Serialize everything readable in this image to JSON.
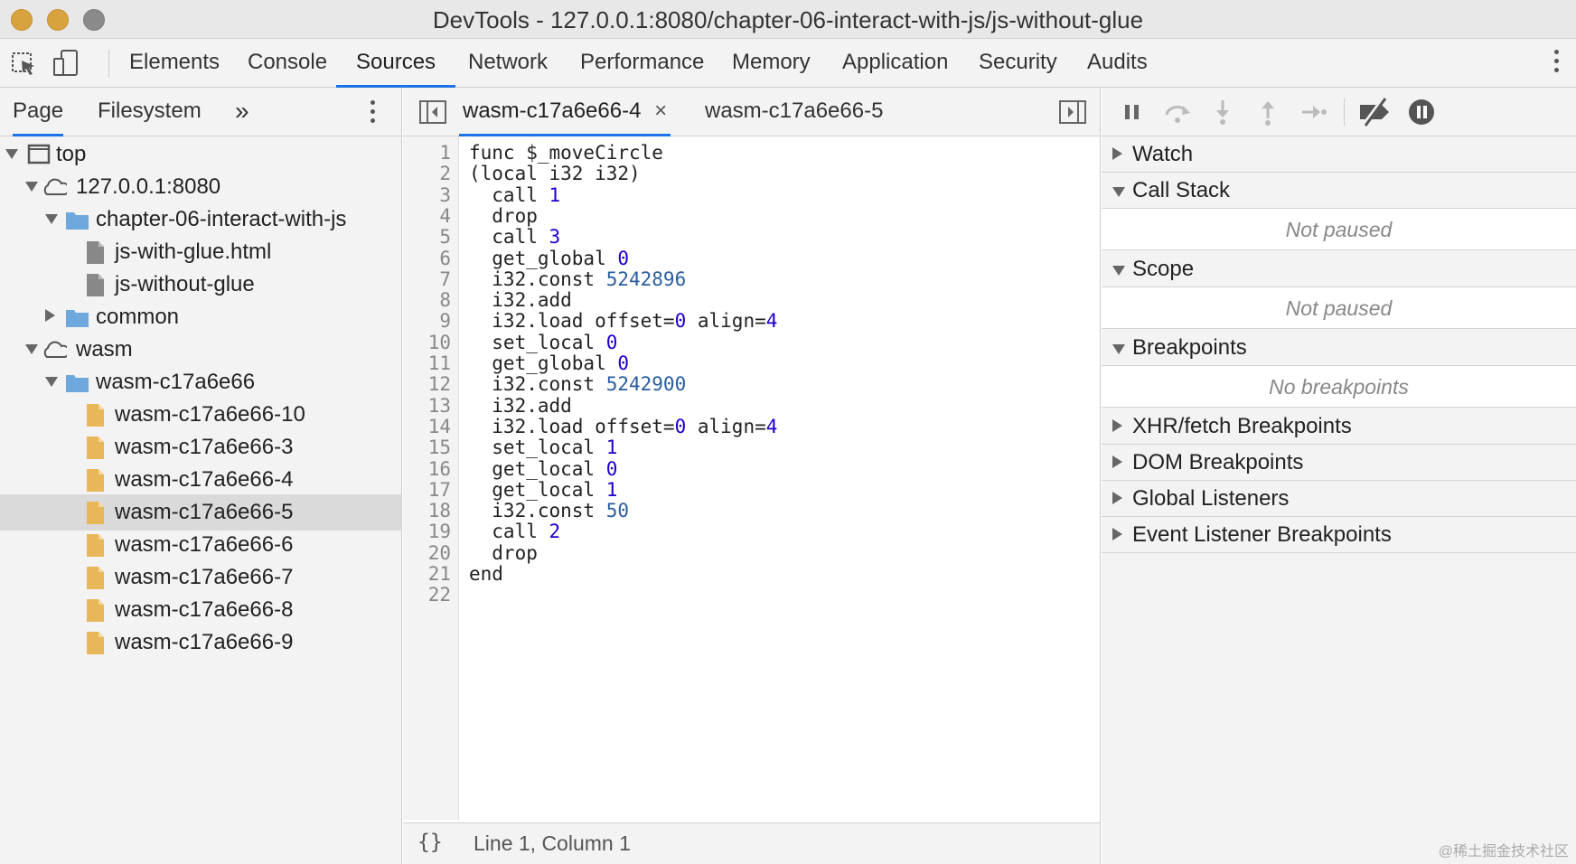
{
  "window": {
    "title": "DevTools - 127.0.0.1:8080/chapter-06-interact-with-js/js-without-glue"
  },
  "toolbar": {
    "tabs": [
      "Elements",
      "Console",
      "Sources",
      "Network",
      "Performance",
      "Memory",
      "Application",
      "Security",
      "Audits"
    ],
    "active_tab": "Sources",
    "icons": [
      "inspect-element-icon",
      "device-toolbar-icon",
      "more-options-icon"
    ]
  },
  "navigator": {
    "tabs": [
      "Page",
      "Filesystem"
    ],
    "more_tabs_label": "»",
    "active_tab": "Page",
    "tree": [
      {
        "label": "top",
        "icon": "frame-icon",
        "depth": 0,
        "expanded": true
      },
      {
        "label": "127.0.0.1:8080",
        "icon": "cloud-icon",
        "depth": 1,
        "expanded": true
      },
      {
        "label": "chapter-06-interact-with-js",
        "icon": "folder-icon",
        "depth": 2,
        "expanded": true
      },
      {
        "label": "js-with-glue.html",
        "icon": "file-icon",
        "depth": 3
      },
      {
        "label": "js-without-glue",
        "icon": "file-icon",
        "depth": 3
      },
      {
        "label": "common",
        "icon": "folder-icon",
        "depth": 2,
        "expanded": false
      },
      {
        "label": "wasm",
        "icon": "cloud-icon",
        "depth": 1,
        "expanded": true
      },
      {
        "label": "wasm-c17a6e66",
        "icon": "folder-icon",
        "depth": 2,
        "expanded": true
      },
      {
        "label": "wasm-c17a6e66-10",
        "icon": "wasm-file-icon",
        "depth": 3
      },
      {
        "label": "wasm-c17a6e66-3",
        "icon": "wasm-file-icon",
        "depth": 3
      },
      {
        "label": "wasm-c17a6e66-4",
        "icon": "wasm-file-icon",
        "depth": 3
      },
      {
        "label": "wasm-c17a6e66-5",
        "icon": "wasm-file-icon",
        "depth": 3,
        "selected": true
      },
      {
        "label": "wasm-c17a6e66-6",
        "icon": "wasm-file-icon",
        "depth": 3
      },
      {
        "label": "wasm-c17a6e66-7",
        "icon": "wasm-file-icon",
        "depth": 3
      },
      {
        "label": "wasm-c17a6e66-8",
        "icon": "wasm-file-icon",
        "depth": 3
      },
      {
        "label": "wasm-c17a6e66-9",
        "icon": "wasm-file-icon",
        "depth": 3
      }
    ]
  },
  "editor": {
    "tabs": [
      {
        "label": "wasm-c17a6e66-4",
        "active": true,
        "close": "×"
      },
      {
        "label": "wasm-c17a6e66-5",
        "active": false
      }
    ],
    "lines": [
      [
        [
          "func $_moveCircle",
          ""
        ]
      ],
      [
        [
          "(local i32 i32)",
          ""
        ]
      ],
      [
        [
          "  call ",
          ""
        ],
        [
          "1",
          "num"
        ]
      ],
      [
        [
          "  drop",
          ""
        ]
      ],
      [
        [
          "  call ",
          ""
        ],
        [
          "3",
          "num"
        ]
      ],
      [
        [
          "  get_global ",
          ""
        ],
        [
          "0",
          "num"
        ]
      ],
      [
        [
          "  i32.const ",
          ""
        ],
        [
          "5242896",
          "num2"
        ]
      ],
      [
        [
          "  i32.add",
          ""
        ]
      ],
      [
        [
          "  i32.load offset=",
          ""
        ],
        [
          "0",
          "num"
        ],
        [
          " align=",
          ""
        ],
        [
          "4",
          "num"
        ]
      ],
      [
        [
          "  set_local ",
          ""
        ],
        [
          "0",
          "num"
        ]
      ],
      [
        [
          "  get_global ",
          ""
        ],
        [
          "0",
          "num"
        ]
      ],
      [
        [
          "  i32.const ",
          ""
        ],
        [
          "5242900",
          "num2"
        ]
      ],
      [
        [
          "  i32.add",
          ""
        ]
      ],
      [
        [
          "  i32.load offset=",
          ""
        ],
        [
          "0",
          "num"
        ],
        [
          " align=",
          ""
        ],
        [
          "4",
          "num"
        ]
      ],
      [
        [
          "  set_local ",
          ""
        ],
        [
          "1",
          "num"
        ]
      ],
      [
        [
          "  get_local ",
          ""
        ],
        [
          "0",
          "num"
        ]
      ],
      [
        [
          "  get_local ",
          ""
        ],
        [
          "1",
          "num"
        ]
      ],
      [
        [
          "  i32.const ",
          ""
        ],
        [
          "50",
          "num2"
        ]
      ],
      [
        [
          "  call ",
          ""
        ],
        [
          "2",
          "num"
        ]
      ],
      [
        [
          "  drop",
          ""
        ]
      ],
      [
        [
          "end",
          ""
        ]
      ],
      [
        [
          "",
          ""
        ]
      ]
    ],
    "status": {
      "format_label": "{}",
      "position": "Line 1, Column 1"
    }
  },
  "debugger": {
    "controls": [
      "pause-icon",
      "step-over-icon",
      "step-into-icon",
      "step-out-icon",
      "step-icon",
      "deactivate-breakpoints-icon",
      "pause-on-exceptions-icon"
    ],
    "sections": [
      {
        "label": "Watch",
        "expanded": false
      },
      {
        "label": "Call Stack",
        "expanded": true,
        "body": "Not paused"
      },
      {
        "label": "Scope",
        "expanded": true,
        "body": "Not paused"
      },
      {
        "label": "Breakpoints",
        "expanded": true,
        "body": "No breakpoints"
      },
      {
        "label": "XHR/fetch Breakpoints",
        "expanded": false
      },
      {
        "label": "DOM Breakpoints",
        "expanded": false
      },
      {
        "label": "Global Listeners",
        "expanded": false
      },
      {
        "label": "Event Listener Breakpoints",
        "expanded": false
      }
    ]
  },
  "watermark": "@稀土掘金技术社区",
  "colors": {
    "accent": "#1a73e8",
    "folder": "#6fa8dc",
    "wasm_file": "#e8b75a",
    "number": "#1c00cf"
  }
}
